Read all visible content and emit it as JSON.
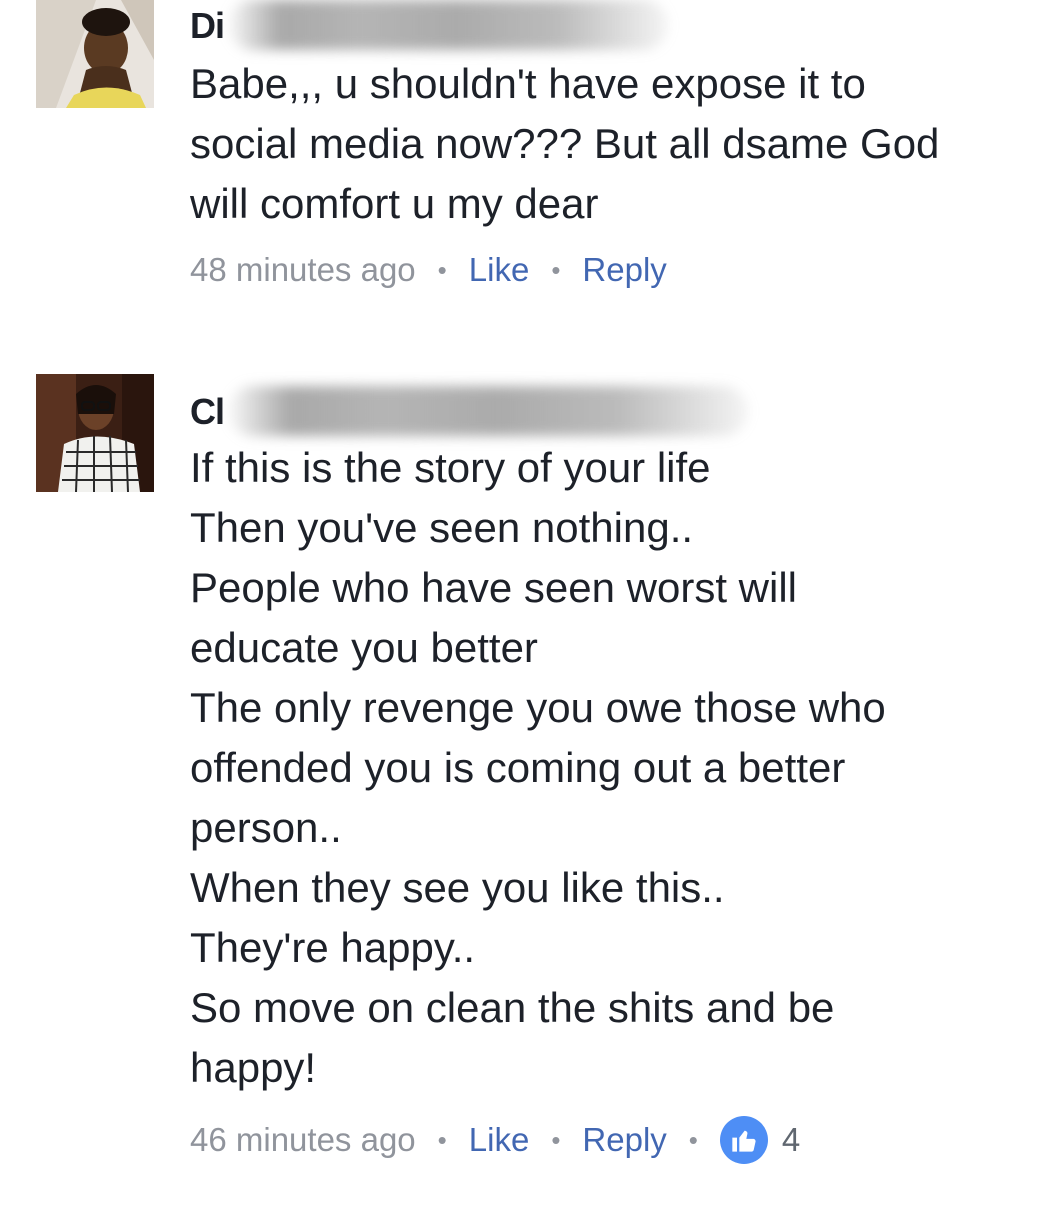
{
  "comments": [
    {
      "author_visible": "Di",
      "avatar_icon": "profile-photo",
      "body_lines": [
        "Babe,,, u shouldn't have expose it to",
        "social media now??? But all dsame God",
        "will comfort u my dear"
      ],
      "timestamp": "48 minutes ago",
      "like_label": "Like",
      "reply_label": "Reply",
      "separator": "•"
    },
    {
      "author_visible": "Cl",
      "avatar_icon": "profile-photo",
      "body_lines": [
        "If this is the story of your life",
        "Then you've seen nothing..",
        "People who have seen worst will",
        "educate you better",
        "The only revenge you owe those who",
        "offended you is coming out a better",
        "person..",
        "When they see you like this..",
        "They're happy..",
        "So move on clean the shits and be",
        "happy!"
      ],
      "timestamp": "46 minutes ago",
      "like_label": "Like",
      "reply_label": "Reply",
      "separator": "•",
      "reaction_icon": "thumbs-up-icon",
      "reaction_count": "4"
    }
  ],
  "colors": {
    "text": "#1d2129",
    "meta": "#90949c",
    "action": "#4267b2",
    "like_badge": "#4e8ef5"
  }
}
